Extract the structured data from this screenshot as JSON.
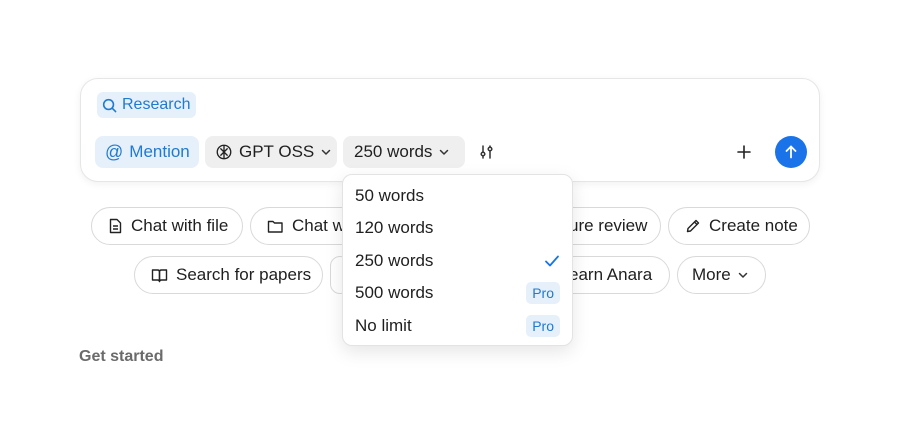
{
  "composer": {
    "mode_chip": "Research",
    "mention_label": "Mention",
    "model_label": "GPT OSS",
    "length_label": "250 words"
  },
  "suggestions": {
    "row1": [
      "Chat with file",
      "Chat w",
      "ure review",
      "Create note"
    ],
    "row2": [
      "Search for papers",
      "earn Anara",
      "More"
    ]
  },
  "get_started": "Get started",
  "length_menu": {
    "items": [
      {
        "label": "50 words"
      },
      {
        "label": "120 words"
      },
      {
        "label": "250 words",
        "selected": true
      },
      {
        "label": "500 words",
        "badge": "Pro"
      },
      {
        "label": "No limit",
        "badge": "Pro"
      }
    ]
  },
  "colors": {
    "accent": "#1a73e8",
    "accent_text": "#1f7ad1",
    "accent_bg": "#e6f0fb"
  }
}
